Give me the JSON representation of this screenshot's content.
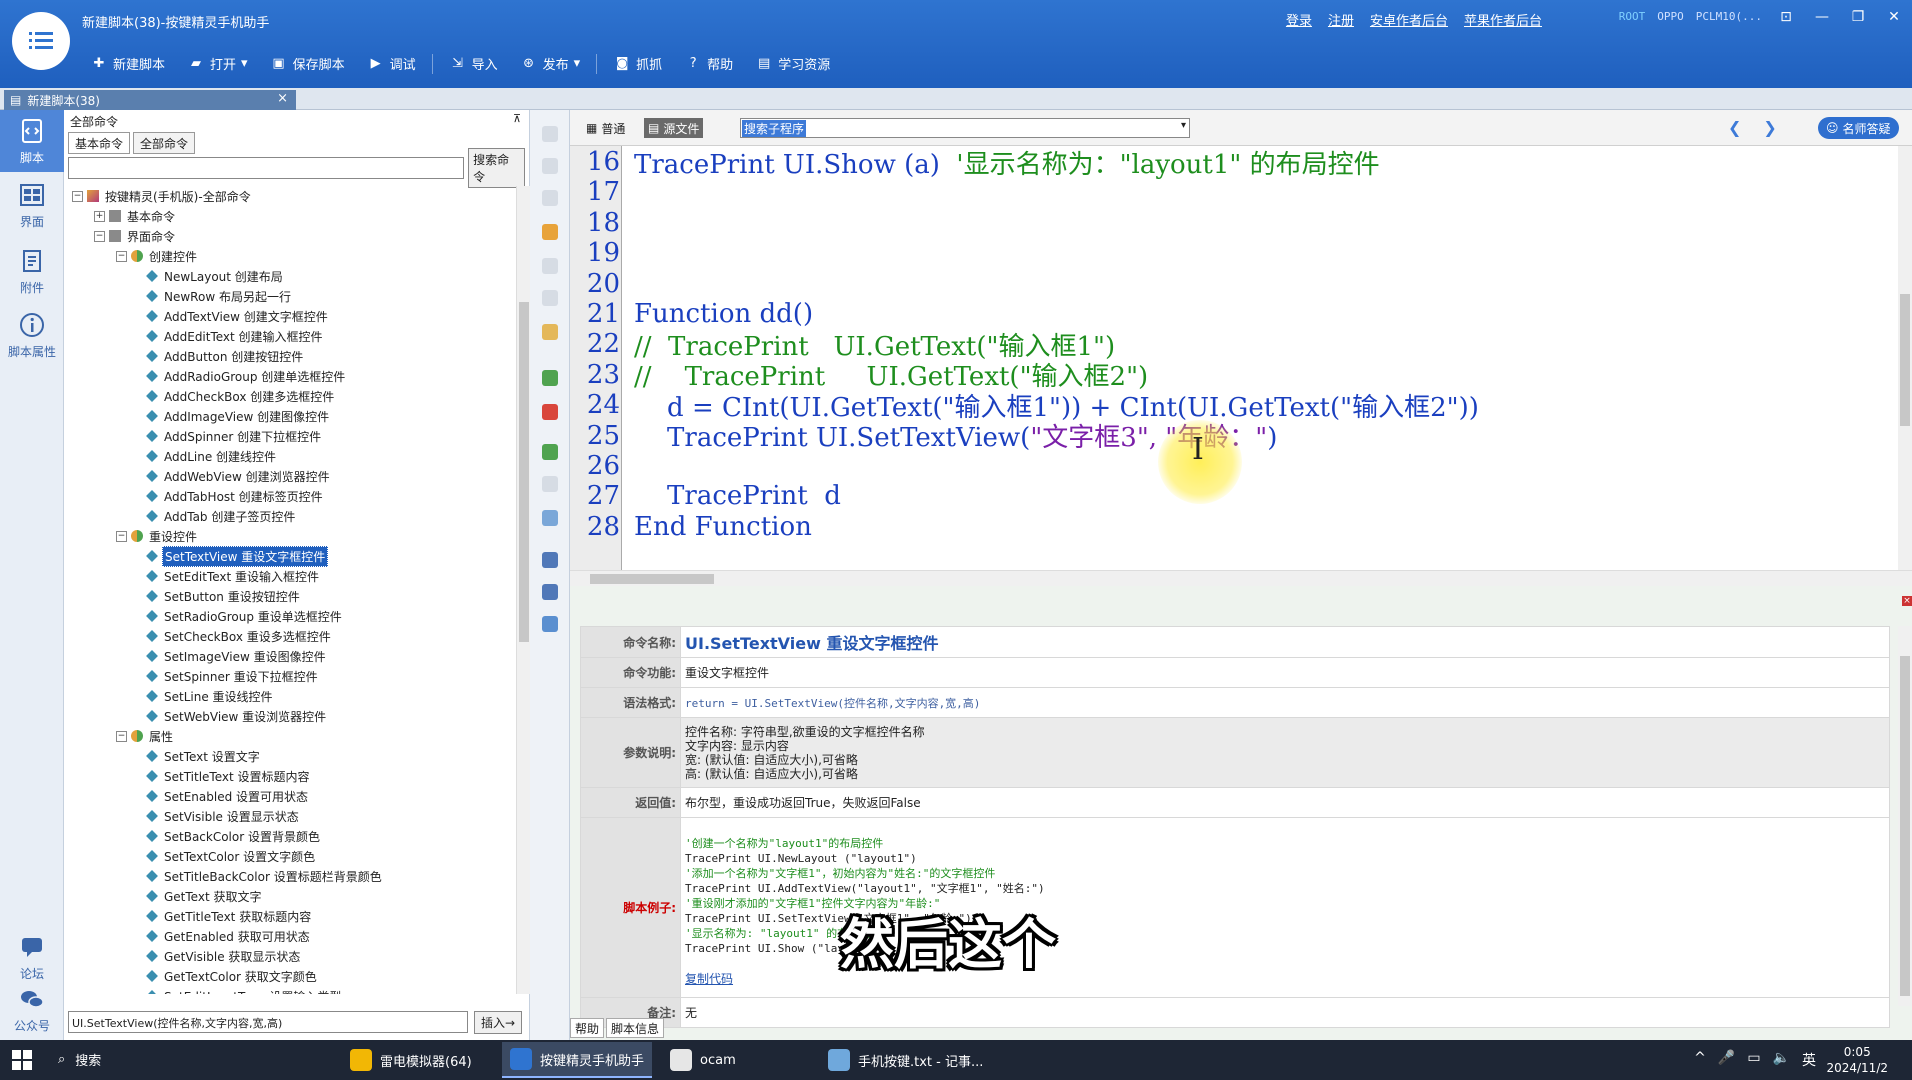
{
  "window": {
    "title": "新建脚本(38)-按键精灵手机助手",
    "top_links": [
      "登录",
      "注册",
      "安卓作者后台",
      "苹果作者后台"
    ],
    "root_status": "ROOT",
    "device_brand": "OPPO",
    "device_model": "PCLM10(...",
    "controls": [
      "⊡",
      "—",
      "❐",
      "✕"
    ]
  },
  "toolbar": [
    {
      "label": "新建脚本",
      "icon": "plus-icon"
    },
    {
      "label": "打开",
      "icon": "folder-icon",
      "dropdown": true
    },
    {
      "label": "保存脚本",
      "icon": "save-icon"
    },
    {
      "label": "调试",
      "icon": "play-icon"
    },
    {
      "label": "导入",
      "icon": "import-icon"
    },
    {
      "label": "发布",
      "icon": "publish-icon",
      "dropdown": true
    },
    {
      "label": "抓抓",
      "icon": "camera-icon"
    },
    {
      "label": "帮助",
      "icon": "help-icon"
    },
    {
      "label": "学习资源",
      "icon": "book-icon"
    }
  ],
  "doc_tab": {
    "label": "新建脚本(38)",
    "close": "×"
  },
  "leftbar": [
    {
      "label": "脚本",
      "icon": "script-icon",
      "active": true
    },
    {
      "label": "界面",
      "icon": "layout-icon"
    },
    {
      "label": "附件",
      "icon": "attachment-icon"
    },
    {
      "label": "脚本属性",
      "icon": "info-icon"
    },
    {
      "label": "论坛",
      "icon": "forum-icon"
    },
    {
      "label": "公众号",
      "icon": "wechat-icon"
    }
  ],
  "cmd_panel": {
    "header": "全部命令",
    "pin": "⊼",
    "tabs": [
      "基本命令",
      "全部命令"
    ],
    "search_button": "搜索命令",
    "insert_field": "UI.SetTextView(控件名称,文字内容,宽,高)",
    "insert_button": "插入→",
    "tree": [
      {
        "level": 0,
        "exp": "-",
        "label": "按键精灵(手机版)-全部命令",
        "kind": "root"
      },
      {
        "level": 1,
        "exp": "+",
        "label": "基本命令",
        "kind": "folder"
      },
      {
        "level": 1,
        "exp": "-",
        "label": "界面命令",
        "kind": "folder"
      },
      {
        "level": 2,
        "exp": "-",
        "label": "创建控件",
        "kind": "group"
      },
      {
        "level": 3,
        "label": "NewLayout 创建布局"
      },
      {
        "level": 3,
        "label": "NewRow 布局另起一行"
      },
      {
        "level": 3,
        "label": "AddTextView 创建文字框控件"
      },
      {
        "level": 3,
        "label": "AddEditText 创建输入框控件"
      },
      {
        "level": 3,
        "label": "AddButton 创建按钮控件"
      },
      {
        "level": 3,
        "label": "AddRadioGroup 创建单选框控件"
      },
      {
        "level": 3,
        "label": "AddCheckBox 创建多选框控件"
      },
      {
        "level": 3,
        "label": "AddImageView 创建图像控件"
      },
      {
        "level": 3,
        "label": "AddSpinner 创建下拉框控件"
      },
      {
        "level": 3,
        "label": "AddLine 创建线控件"
      },
      {
        "level": 3,
        "label": "AddWebView 创建浏览器控件"
      },
      {
        "level": 3,
        "label": "AddTabHost 创建标签页控件"
      },
      {
        "level": 3,
        "label": "AddTab 创建子签页控件"
      },
      {
        "level": 2,
        "exp": "-",
        "label": "重设控件",
        "kind": "group"
      },
      {
        "level": 3,
        "label": "SetTextView 重设文字框控件",
        "selected": true
      },
      {
        "level": 3,
        "label": "SetEditText 重设输入框控件"
      },
      {
        "level": 3,
        "label": "SetButton 重设按钮控件"
      },
      {
        "level": 3,
        "label": "SetRadioGroup 重设单选框控件"
      },
      {
        "level": 3,
        "label": "SetCheckBox 重设多选框控件"
      },
      {
        "level": 3,
        "label": "SetImageView 重设图像控件"
      },
      {
        "level": 3,
        "label": "SetSpinner 重设下拉框控件"
      },
      {
        "level": 3,
        "label": "SetLine 重设线控件"
      },
      {
        "level": 3,
        "label": "SetWebView 重设浏览器控件"
      },
      {
        "level": 2,
        "exp": "-",
        "label": "属性",
        "kind": "group"
      },
      {
        "level": 3,
        "label": "SetText 设置文字"
      },
      {
        "level": 3,
        "label": "SetTitleText 设置标题内容"
      },
      {
        "level": 3,
        "label": "SetEnabled 设置可用状态"
      },
      {
        "level": 3,
        "label": "SetVisible 设置显示状态"
      },
      {
        "level": 3,
        "label": "SetBackColor 设置背景颜色"
      },
      {
        "level": 3,
        "label": "SetTextColor 设置文字颜色"
      },
      {
        "level": 3,
        "label": "SetTitleBackColor 设置标题栏背景颜色"
      },
      {
        "level": 3,
        "label": "GetText 获取文字"
      },
      {
        "level": 3,
        "label": "GetTitleText 获取标题内容"
      },
      {
        "level": 3,
        "label": "GetEnabled 获取可用状态"
      },
      {
        "level": 3,
        "label": "GetVisible 获取显示状态"
      },
      {
        "level": 3,
        "label": "GetTextColor 获取文字颜色"
      },
      {
        "level": 3,
        "label": "SetEditInputType 设置输入类型"
      }
    ]
  },
  "editor": {
    "tabs": [
      "普通",
      "源文件"
    ],
    "active_tab": 1,
    "sub_select": "搜索子程序",
    "help_button": "名师答疑",
    "lines": [
      {
        "n": "16",
        "segs": [
          {
            "t": "TracePrint UI.Show (a)  ",
            "c": "kw"
          },
          {
            "t": "'显示名称为：\"layout1\" 的布局控件",
            "c": "cmt"
          }
        ]
      },
      {
        "n": "17",
        "segs": []
      },
      {
        "n": "18",
        "segs": []
      },
      {
        "n": "19",
        "segs": []
      },
      {
        "n": "20",
        "segs": []
      },
      {
        "n": "21",
        "segs": [
          {
            "t": "Function dd()",
            "c": "kw"
          }
        ]
      },
      {
        "n": "22",
        "segs": [
          {
            "t": "//  TracePrint   UI.GetText(\"输入框1\")",
            "c": "cmt"
          }
        ]
      },
      {
        "n": "23",
        "segs": [
          {
            "t": "//    TracePrint     UI.GetText(\"输入框2\")",
            "c": "cmt"
          }
        ]
      },
      {
        "n": "24",
        "segs": [
          {
            "t": "    d = CInt(UI.GetText(\"输入框1\")) + CInt(UI.GetText(\"输入框2\"))",
            "c": "kw"
          }
        ]
      },
      {
        "n": "25",
        "segs": [
          {
            "t": "    TracePrint UI.SetTextView(",
            "c": "kw"
          },
          {
            "t": "\"文字框3\", \"年龄：\"",
            "c": "str"
          },
          {
            "t": ")",
            "c": "kw"
          }
        ]
      },
      {
        "n": "26",
        "segs": []
      },
      {
        "n": "27",
        "segs": [
          {
            "t": "    TracePrint  d",
            "c": "kw"
          }
        ]
      },
      {
        "n": "28",
        "segs": [
          {
            "t": "End Function",
            "c": "kw"
          }
        ]
      }
    ]
  },
  "info": {
    "rows": [
      {
        "key": "命令名称:",
        "value": "UI.SetTextView 重设文字框控件",
        "style": "name"
      },
      {
        "key": "命令功能:",
        "value": "重设文字框控件"
      },
      {
        "key": "语法格式:",
        "value": "return = UI.SetTextView(控件名称,文字内容,宽,高)",
        "style": "syntax"
      },
      {
        "key": "参数说明:",
        "lines": [
          "控件名称: 字符串型,欲重设的文字框控件名称",
          "文字内容: 显示内容",
          "宽: (默认值: 自适应大小),可省略",
          "高: (默认值: 自适应大小),可省略"
        ],
        "shade": true
      },
      {
        "key": "返回值:",
        "value": "布尔型，重设成功返回True，失败返回False"
      },
      {
        "key": "脚本例子:",
        "red": true,
        "example": [
          {
            "t": "'创建一个名称为\"layout1\"的布局控件",
            "c": true
          },
          {
            "t": "TracePrint UI.NewLayout (\"layout1\")"
          },
          {
            "t": "'添加一个名称为\"文字框1\"，初始内容为\"姓名:\"的文字框控件",
            "c": true
          },
          {
            "t": "TracePrint UI.AddTextView(\"layout1\", \"文字框1\", \"姓名:\")"
          },
          {
            "t": "'重设刚才添加的\"文字框1\"控件文字内容为\"年龄:\"",
            "c": true
          },
          {
            "t": "TracePrint UI.SetTextView(\"文字框1\", \"年龄:\")"
          },
          {
            "t": "'显示名称为: \"layout1\" 的布局控件",
            "c": true
          },
          {
            "t": "TracePrint UI.Show (\"layout1\")"
          }
        ],
        "copy": "复制代码"
      },
      {
        "key": "备注:",
        "value": "无"
      }
    ],
    "bottom_tabs": [
      "帮助",
      "脚本信息"
    ]
  },
  "subtitle": "然后这个",
  "taskbar": {
    "search": "搜索",
    "apps": [
      {
        "label": "雷电模拟器(64)",
        "color": "#f2b705"
      },
      {
        "label": "按键精灵手机助手",
        "color": "#2f74d0",
        "active": true
      },
      {
        "label": "ocam",
        "color": "#e6e6e6"
      },
      {
        "label": "手机按键.txt - 记事...",
        "color": "#6fa8dc"
      }
    ],
    "tray": [
      "^",
      "🎤",
      "▭",
      "🔈",
      "英"
    ],
    "time": "0:05",
    "date": "2024/11/2"
  }
}
